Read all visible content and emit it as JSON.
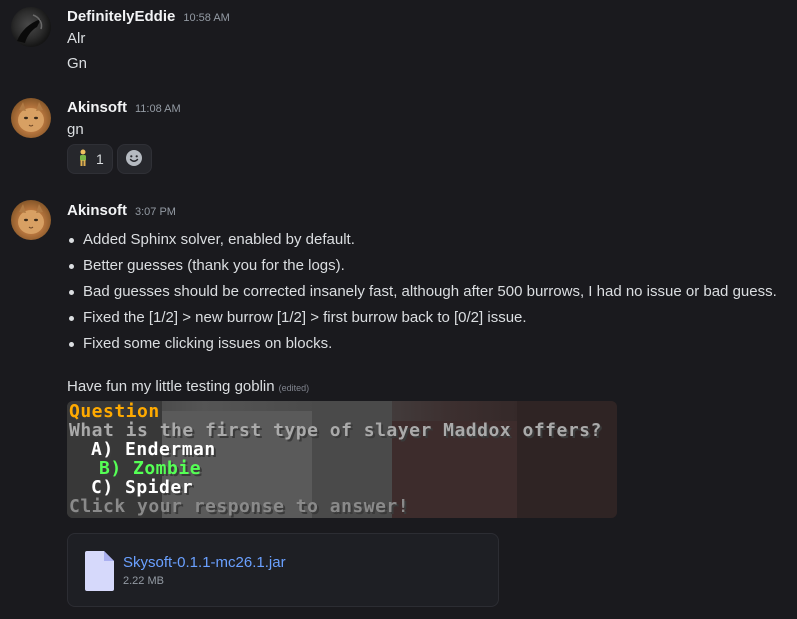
{
  "messages": [
    {
      "username": "DefinitelyEddie",
      "timestamp": "10:58 AM",
      "lines": [
        "Alr",
        "Gn"
      ]
    },
    {
      "username": "Akinsoft",
      "timestamp": "11:08 AM",
      "lines": [
        "gn"
      ],
      "reactions": [
        {
          "emoji": "person-standing-emoji",
          "count": "1"
        },
        {
          "emoji": "add-reaction-icon"
        }
      ]
    },
    {
      "username": "Akinsoft",
      "timestamp": "3:07 PM",
      "bullets": [
        "Added Sphinx solver, enabled by default.",
        "Better guesses (thank you for the logs).",
        "Bad guesses should be corrected insanely fast, although after 500 burrows, I had no issue or bad guess.",
        "Fixed the [1/2] > new burrow [1/2] > first burrow back to [0/2] issue.",
        "Fixed some clicking issues on blocks."
      ],
      "text": "Have fun my little testing goblin",
      "edited_label": "(edited)",
      "image": {
        "title": "Question",
        "question": "What is the first type of slayer Maddox offers?",
        "options": [
          "A) Enderman",
          "B) Zombie",
          "C) Spider"
        ],
        "footer": "Click your response to answer!",
        "colors": {
          "title": "#ffaa00",
          "text": "#aaaaaa",
          "option": "#ffffff",
          "selected": "#55ff55"
        }
      },
      "attachment": {
        "filename": "Skysoft-0.1.1-mc26.1.jar",
        "size": "2.22 MB"
      }
    }
  ],
  "colors": {
    "background": "#1a1a1e",
    "username": "#f2f3f5",
    "text": "#dbdee1",
    "muted": "#949ba4",
    "link": "#6aa0ff"
  }
}
